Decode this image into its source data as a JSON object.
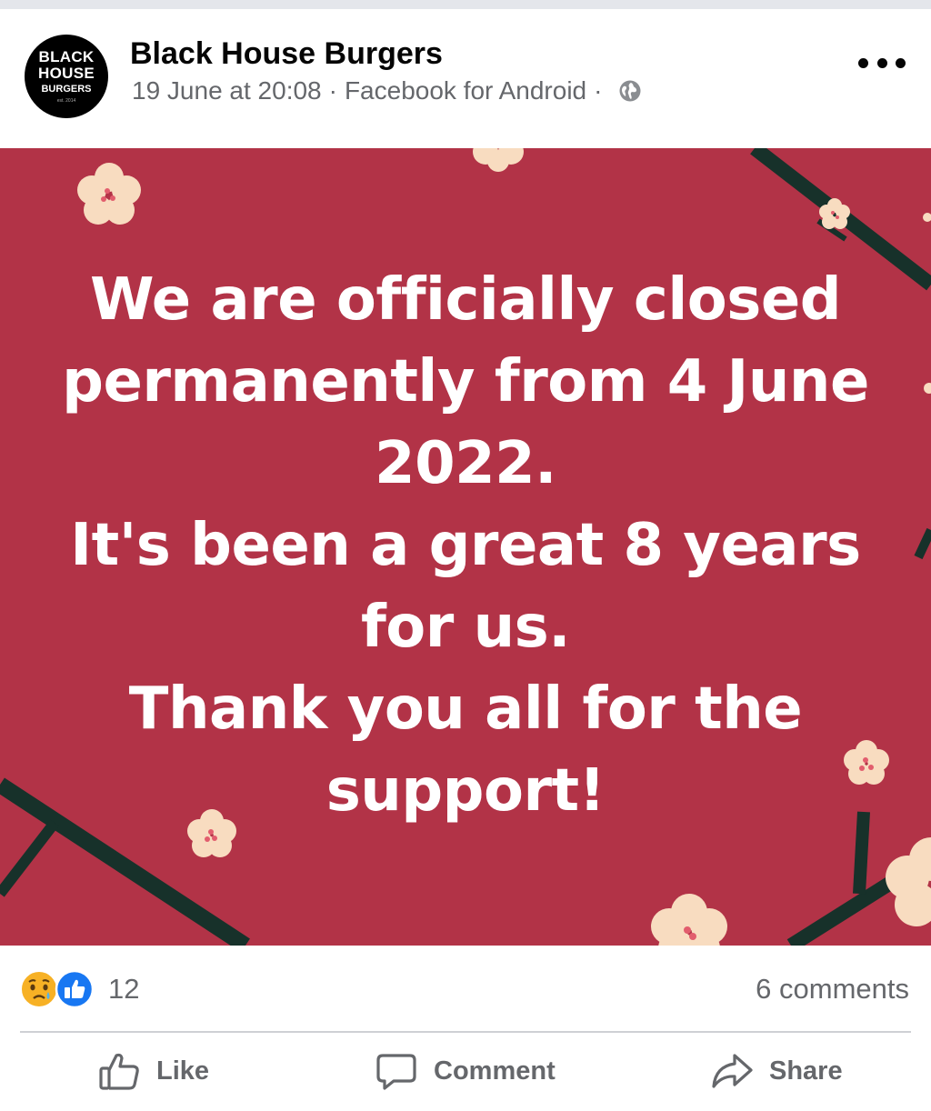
{
  "post": {
    "page_name": "Black House Burgers",
    "avatar": {
      "line1": "BLACK",
      "line2": "HOUSE",
      "line3": "BURGERS",
      "line4": "est. 2014"
    },
    "timestamp": "19 June at 20:08",
    "separator": "·",
    "source": "Facebook for Android",
    "privacy_icon": "globe-icon",
    "more_icon": "more-options-icon"
  },
  "image": {
    "background_color": "#b23347",
    "lines": [
      "We are officially closed",
      "permanently from 4 June",
      "2022.",
      "It's been a great 8 years",
      "for us.",
      "Thank you all for the",
      "support!"
    ]
  },
  "stats": {
    "reaction_icons": [
      "sad-reaction-icon",
      "like-reaction-icon"
    ],
    "reaction_count": "12",
    "comments": "6 comments"
  },
  "actions": {
    "like": "Like",
    "comment": "Comment",
    "share": "Share"
  },
  "colors": {
    "text_primary": "#050505",
    "text_secondary": "#65676b",
    "like_blue": "#1877f2",
    "divider": "#ced0d4"
  }
}
